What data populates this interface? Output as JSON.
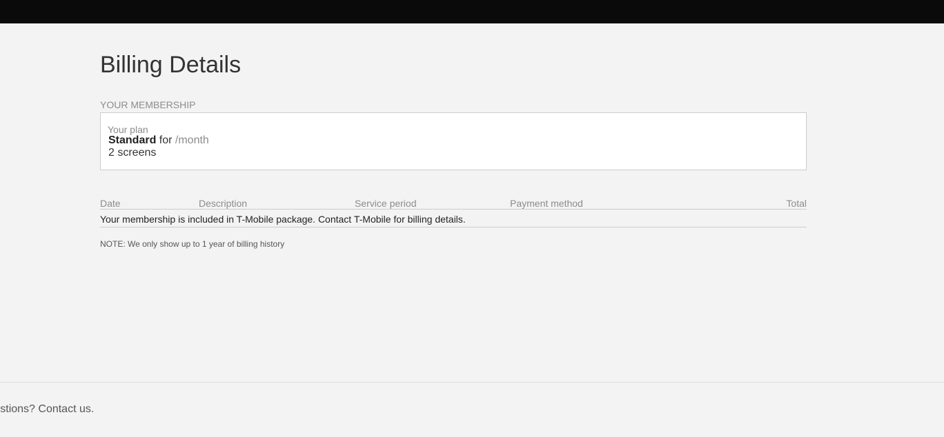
{
  "page": {
    "title": "Billing Details"
  },
  "membership": {
    "section_label": "YOUR MEMBERSHIP",
    "plan_caption": "Your plan",
    "plan_name": "Standard",
    "plan_for": " for ",
    "plan_price": "/month",
    "screens": "2 screens"
  },
  "billing_table": {
    "columns": [
      "Date",
      "Description",
      "Service period",
      "Payment method",
      "Total"
    ],
    "message": "Your membership is included in T-Mobile package. Contact T-Mobile for billing details."
  },
  "note": "NOTE: We only show up to 1 year of billing history",
  "footer": {
    "text": "Questions? Contact us."
  },
  "colors": {
    "top_bar": "#0a0a0a",
    "background": "#f3f3f3",
    "box_background": "#ffffff",
    "muted_text": "#8c8c8c"
  }
}
